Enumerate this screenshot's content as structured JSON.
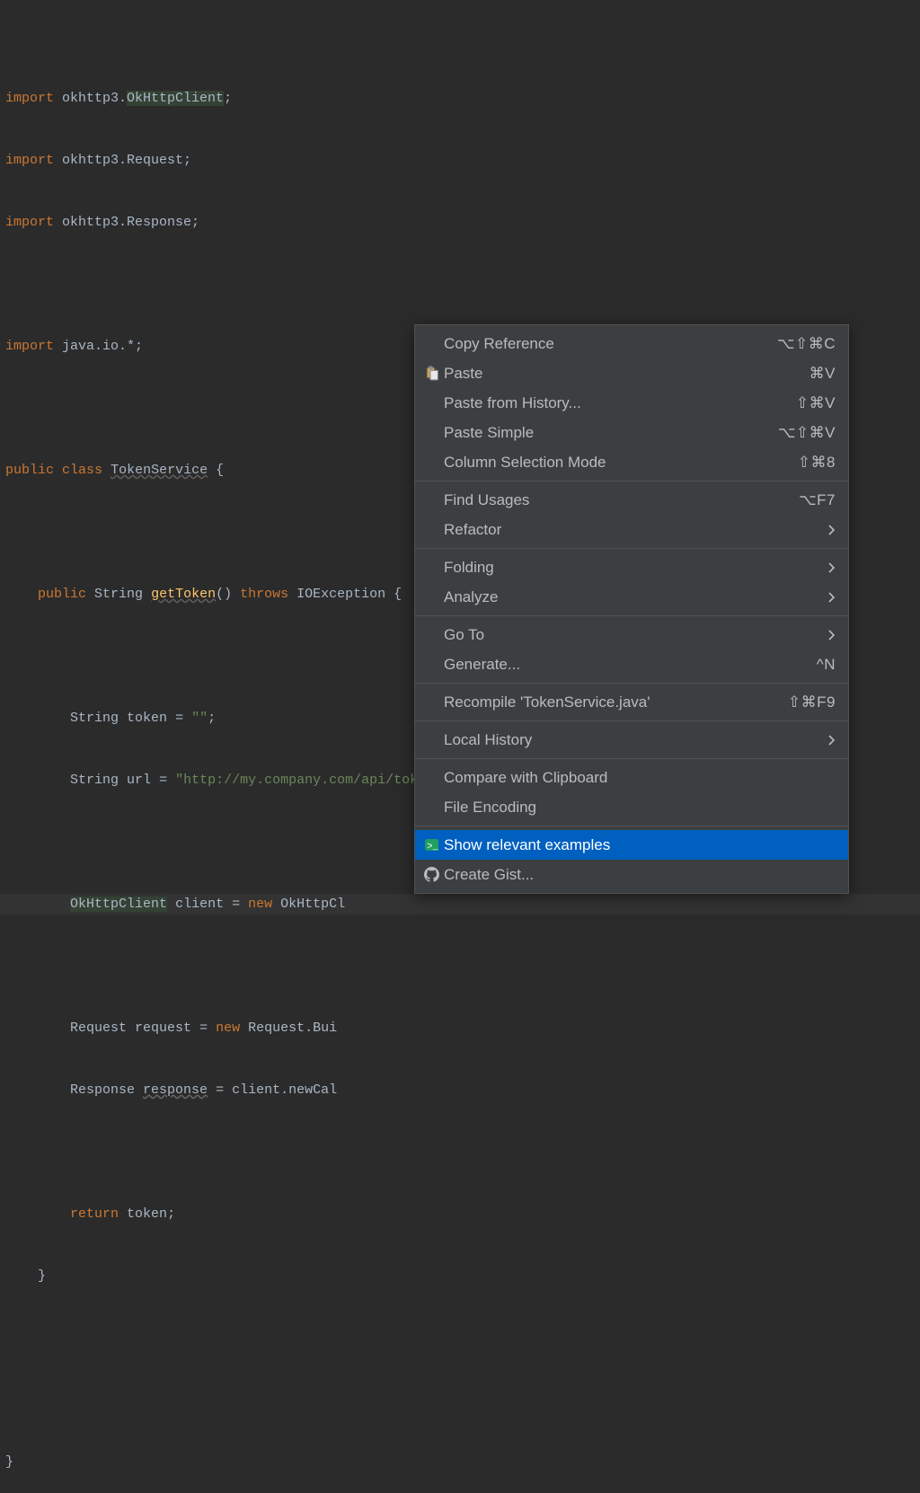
{
  "code": {
    "l1": {
      "import": "import",
      "pkg": " okhttp3.",
      "cls": "OkHttpClient",
      "end": ";"
    },
    "l2": {
      "import": "import",
      "pkg": " okhttp3.",
      "cls": "Request",
      "end": ";"
    },
    "l3": {
      "import": "import",
      "pkg": " okhttp3.",
      "cls": "Response",
      "end": ";"
    },
    "l4": {
      "import": "import",
      "pkg": " java.io.*;",
      "end": ""
    },
    "l5": {
      "kw1": "public",
      "sp1": " ",
      "kw2": "class",
      "sp2": " ",
      "name": "TokenService",
      "sp3": " ",
      "brace": "{"
    },
    "l6": {
      "lead": "    ",
      "kw1": "public",
      "sp1": " ",
      "type": "String",
      "sp2": " ",
      "name": "getToken",
      "paren": "() ",
      "kw2": "throws",
      "ex": " IOException ",
      "brace": "{"
    },
    "l7": {
      "lead": "        ",
      "type": "String",
      "sp": " ",
      "var": "token",
      "assign": " = ",
      "val": "\"\"",
      "end": ";"
    },
    "l8": {
      "lead": "        ",
      "type": "String",
      "sp": " ",
      "var": "url",
      "assign": " = ",
      "val": "\"http://my.company.com/api/token\"",
      "end": ";"
    },
    "l9": {
      "lead": "        ",
      "type": "OkHttpClient",
      "sp": " ",
      "var": "client",
      "assign": " = ",
      "kw": "new",
      "sp2": " ",
      "cls": "OkHttpCl"
    },
    "l10": {
      "lead": "        ",
      "type": "Request",
      "sp": " ",
      "var": "request",
      "assign": " = ",
      "kw": "new",
      "sp2": " ",
      "cls": "Request.Bui"
    },
    "l11": {
      "lead": "        ",
      "type": "Response",
      "sp": " ",
      "var": "response",
      "assign": " = client.newCal"
    },
    "l12": {
      "lead": "        ",
      "kw": "return",
      "sp": " ",
      "var": "token",
      "end": ";"
    },
    "l13": {
      "lead": "    ",
      "brace": "}"
    },
    "l14": {
      "brace": "}"
    }
  },
  "menu": {
    "items": [
      {
        "label": "Copy Reference",
        "shortcut": "⌥⇧⌘C",
        "icon": "",
        "submenu": false
      },
      {
        "label": "Paste",
        "shortcut": "⌘V",
        "icon": "paste",
        "submenu": false
      },
      {
        "label": "Paste from History...",
        "shortcut": "⇧⌘V",
        "icon": "",
        "submenu": false
      },
      {
        "label": "Paste Simple",
        "shortcut": "⌥⇧⌘V",
        "icon": "",
        "submenu": false
      },
      {
        "label": "Column Selection Mode",
        "shortcut": "⇧⌘8",
        "icon": "",
        "submenu": false
      },
      {
        "sep": true
      },
      {
        "label": "Find Usages",
        "shortcut": "⌥F7",
        "icon": "",
        "submenu": false
      },
      {
        "label": "Refactor",
        "shortcut": "",
        "icon": "",
        "submenu": true
      },
      {
        "sep": true
      },
      {
        "label": "Folding",
        "shortcut": "",
        "icon": "",
        "submenu": true
      },
      {
        "label": "Analyze",
        "shortcut": "",
        "icon": "",
        "submenu": true
      },
      {
        "sep": true
      },
      {
        "label": "Go To",
        "shortcut": "",
        "icon": "",
        "submenu": true
      },
      {
        "label": "Generate...",
        "shortcut": "^N",
        "icon": "",
        "submenu": false
      },
      {
        "sep": true
      },
      {
        "label": "Recompile 'TokenService.java'",
        "shortcut": "⇧⌘F9",
        "icon": "",
        "submenu": false
      },
      {
        "sep": true
      },
      {
        "label": "Local History",
        "shortcut": "",
        "icon": "",
        "submenu": true
      },
      {
        "sep": true
      },
      {
        "label": "Compare with Clipboard",
        "shortcut": "",
        "icon": "",
        "submenu": false
      },
      {
        "label": "File Encoding",
        "shortcut": "",
        "icon": "",
        "submenu": false
      },
      {
        "sep": true
      },
      {
        "label": "Show relevant examples",
        "shortcut": "",
        "icon": "terminal",
        "submenu": false,
        "selected": true
      },
      {
        "label": "Create Gist...",
        "shortcut": "",
        "icon": "github",
        "submenu": false
      }
    ]
  }
}
